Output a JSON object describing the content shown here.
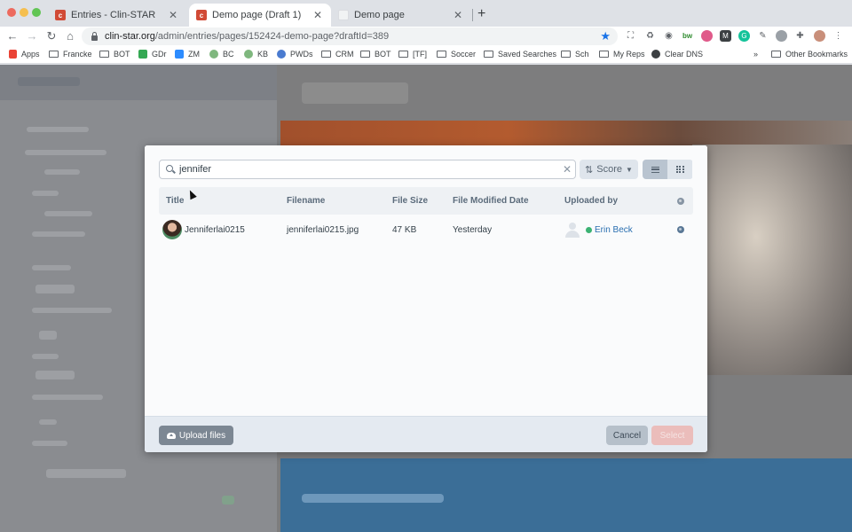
{
  "browser": {
    "tabs": [
      {
        "label": "Entries - Clin-STAR",
        "active": false,
        "favicon": "c-logo-icon"
      },
      {
        "label": "Demo page (Draft 1)",
        "active": true,
        "favicon": "c-logo-icon"
      },
      {
        "label": "Demo page",
        "active": false,
        "favicon": "blank-page-icon"
      }
    ],
    "url_host": "clin-star.org",
    "url_path": "/admin/entries/pages/152424-demo-page?draftId=389",
    "bookmarks": [
      "Apps",
      "Francke",
      "BOT",
      "GDr",
      "ZM",
      "BC",
      "KB",
      "PWDs",
      "CRM",
      "BOT",
      "[TF]",
      "Soccer",
      "Saved Searches",
      "Sch",
      "My Reps",
      "Clear DNS"
    ],
    "more_bookmarks": "»",
    "other_bookmarks": "Other Bookmarks"
  },
  "modal": {
    "search_value": "jennifer",
    "sort_label": "Score",
    "columns": [
      "Title",
      "Filename",
      "File Size",
      "File Modified Date",
      "Uploaded by"
    ],
    "rows": [
      {
        "title": "Jenniferlai0215",
        "filename": "jenniferlai0215.jpg",
        "size": "47 KB",
        "modified": "Yesterday",
        "uploaded_by": "Erin Beck"
      }
    ],
    "upload_label": "Upload files",
    "cancel_label": "Cancel",
    "select_label": "Select"
  },
  "colors": {
    "accent": "#2a6fb0",
    "online": "#3bb273",
    "select_disabled": "#ebbdbb"
  }
}
